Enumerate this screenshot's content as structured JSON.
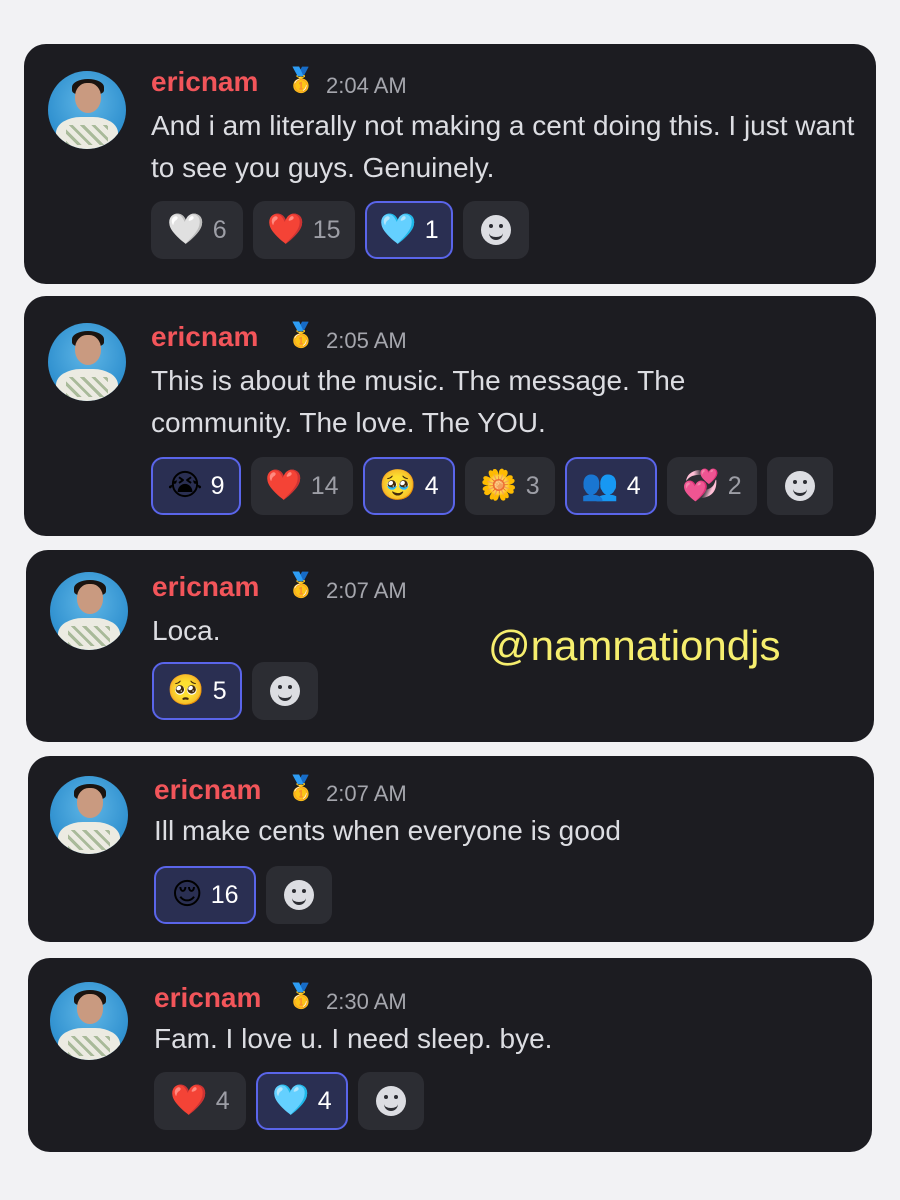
{
  "watermark": "@namnationdjs",
  "messages": [
    {
      "author": "ericnam",
      "badge_icon": "medal-icon",
      "time": "2:04 AM",
      "text": "And i am literally not making a cent doing this. I just want to see you guys. Genuinely.",
      "reactions": [
        {
          "emoji": "🤍",
          "name": "white-heart-icon",
          "count": "6",
          "me": false
        },
        {
          "emoji": "❤️",
          "name": "red-heart-icon",
          "count": "15",
          "me": false
        },
        {
          "emoji": "🩵",
          "name": "light-blue-heart-icon",
          "count": "1",
          "me": true
        }
      ]
    },
    {
      "author": "ericnam",
      "badge_icon": "medal-icon",
      "time": "2:05 AM",
      "text": "This is about the music. The message. The community. The love. The YOU.",
      "reactions": [
        {
          "emoji": "😭",
          "name": "loudly-crying-face-icon",
          "count": "9",
          "me": true
        },
        {
          "emoji": "❤️",
          "name": "red-heart-icon",
          "count": "14",
          "me": false
        },
        {
          "emoji": "🥹",
          "name": "holding-back-tears-face-icon",
          "count": "4",
          "me": true
        },
        {
          "emoji": "🌼",
          "name": "blossom-icon",
          "count": "3",
          "me": false
        },
        {
          "emoji": "👥",
          "name": "hug-people-icon",
          "count": "4",
          "me": true
        },
        {
          "emoji": "💞",
          "name": "revolving-hearts-icon",
          "count": "2",
          "me": false
        }
      ]
    },
    {
      "author": "ericnam",
      "badge_icon": "medal-icon",
      "time": "2:07 AM",
      "text": "Loca.",
      "reactions": [
        {
          "emoji": "🥺",
          "name": "pleading-face-icon",
          "count": "5",
          "me": true
        }
      ]
    },
    {
      "author": "ericnam",
      "badge_icon": "medal-icon",
      "time": "2:07 AM",
      "text": "Ill make cents when everyone is good",
      "reactions": [
        {
          "emoji": "😌",
          "name": "relieved-face-icon",
          "count": "16",
          "me": true
        }
      ]
    },
    {
      "author": "ericnam",
      "badge_icon": "medal-icon",
      "time": "2:30 AM",
      "text": "Fam. I love u. I need sleep. bye.",
      "reactions": [
        {
          "emoji": "❤️",
          "name": "red-heart-icon",
          "count": "4",
          "me": false
        },
        {
          "emoji": "🩵",
          "name": "light-blue-heart-icon",
          "count": "4",
          "me": true
        }
      ]
    }
  ]
}
